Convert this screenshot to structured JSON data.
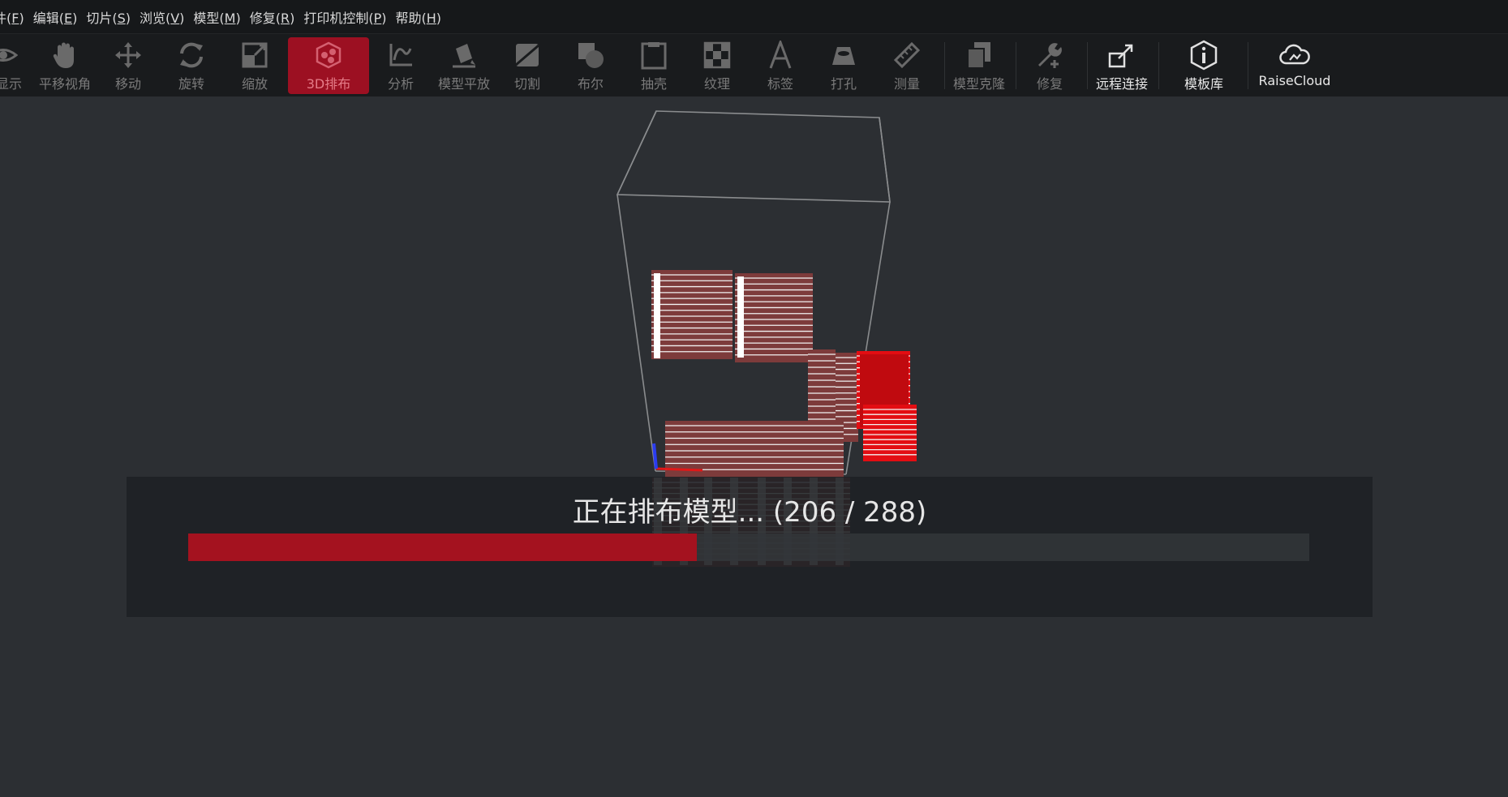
{
  "menu": [
    {
      "text": "件(",
      "key": "F",
      "end": ")"
    },
    {
      "text": "编辑(",
      "key": "E",
      "end": ")"
    },
    {
      "text": "切片(",
      "key": "S",
      "end": ")"
    },
    {
      "text": "浏览(",
      "key": "V",
      "end": ")"
    },
    {
      "text": "模型(",
      "key": "M",
      "end": ")"
    },
    {
      "text": "修复(",
      "key": "R",
      "end": ")"
    },
    {
      "text": "打印机控制(",
      "key": "P",
      "end": ")"
    },
    {
      "text": "帮助(",
      "key": "H",
      "end": ")"
    }
  ],
  "toolbar": {
    "show": "显示",
    "pan_view": "平移视角",
    "move": "移动",
    "rotate": "旋转",
    "scale": "缩放",
    "arrange_3d": "3D排布",
    "analyze": "分析",
    "lay_flat": "模型平放",
    "cut": "切割",
    "boolean": "布尔",
    "hollow": "抽壳",
    "texture": "纹理",
    "label": "标签",
    "punch": "打孔",
    "measure": "测量",
    "clone": "模型克隆",
    "repair": "修复",
    "remote": "远程连接",
    "templates": "模板库",
    "raisecloud": "RaiseCloud"
  },
  "progress": {
    "message": "正在排布模型... (206 / 288)",
    "current": 206,
    "total": 288,
    "fraction": 0.4539
  },
  "colors": {
    "accent": "#9c1022",
    "progress": "#a4121f",
    "model_selected": "#e30d12",
    "model": "#7d3b3b"
  }
}
